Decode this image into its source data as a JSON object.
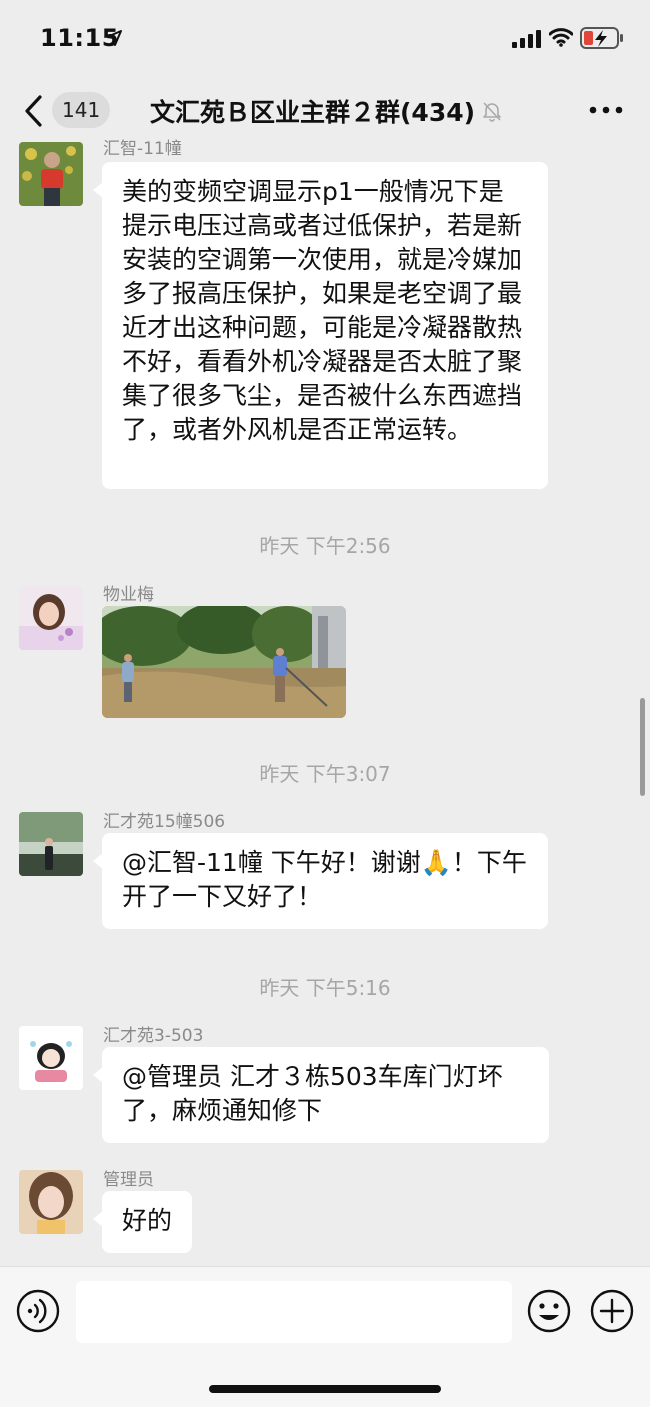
{
  "status_bar": {
    "time": "11:15"
  },
  "header": {
    "unread_count": "141",
    "title": "文汇苑Ｂ区业主群２群(434)"
  },
  "messages": [
    {
      "sender": "汇智-11幢",
      "text": "美的变频空调显示p1一般情况下是提示电压过高或者过低保护，若是新安装的空调第一次使用，就是冷媒加多了报高压保护，如果是老空调了最近才出这种问题，可能是冷凝器散热不好，看看外机冷凝器是否太脏了聚集了很多飞尘，是否被什么东西遮挡了，或者外风机是否正常运转。"
    },
    {
      "sender": "物业梅",
      "image": "garden-workers-photo"
    },
    {
      "sender": "汇才苑15幢506",
      "text": "@汇智-11幢 下午好！谢谢🙏！下午开了一下又好了！"
    },
    {
      "sender": "汇才苑3-503",
      "text": "@管理员 汇才３栋503车库门灯坏了，麻烦通知修下"
    },
    {
      "sender": "管理员",
      "text": "好的"
    }
  ],
  "timestamps": [
    "昨天 下午2:56",
    "昨天 下午3:07",
    "昨天 下午5:16"
  ],
  "input": {
    "placeholder": ""
  },
  "icons": {
    "back": "chevron-left-icon",
    "mute": "bell-slash-icon",
    "more": "ellipsis-icon",
    "voice": "voice-icon",
    "emoji": "emoji-icon",
    "plus": "plus-circle-icon"
  }
}
